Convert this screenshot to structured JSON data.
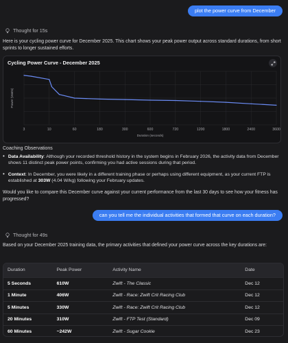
{
  "messages": {
    "user_1": "plot the power curve from December",
    "thought_1": "Thought for 15s",
    "intro": "Here is your cycling power curve for December 2025. This chart shows your peak power output across standard durations, from short sprints to longer sustained efforts.",
    "observations_heading": "Coaching Observations",
    "bullets": [
      {
        "label": "Data Availability",
        "text": ": Although your recorded threshold history in the system begins in February 2026, the activity data from December shows 11 distinct peak power points, confirming you had active sessions during that period."
      },
      {
        "label": "Context",
        "text": ": In December, you were likely in a different training phase or perhaps using different equipment, as your current FTP is established at ",
        "bold2": "303W",
        "tail": " (4.04 W/kg) following your February updates."
      }
    ],
    "followup_question": "Would you like to compare this December curve against your current performance from the last 30 days to see how your fitness has progressed?",
    "user_2": "can you tell me the individual activities that formed that curve on each duration?",
    "thought_2": "Thought for 49s",
    "answer_intro": "Based on your December 2025 training data, the primary activities that defined your power curve across the key durations are:"
  },
  "chart_data": {
    "type": "line",
    "title": "Cycling Power Curve - December 2025",
    "xlabel": "Duration (seconds)",
    "ylabel": "Power (Watts)",
    "x_ticks": [
      "3",
      "10",
      "60",
      "180",
      "300",
      "600",
      "720",
      "1200",
      "1800",
      "2400",
      "3600"
    ],
    "x": [
      3,
      5,
      10,
      15,
      30,
      60,
      180,
      300,
      600,
      720,
      1200,
      1800,
      2400,
      3600
    ],
    "y": [
      610,
      600,
      560,
      470,
      375,
      330,
      318,
      312,
      305,
      300,
      290,
      278,
      260,
      242
    ],
    "ylim": [
      0,
      660
    ],
    "grid": true,
    "line_color": "#6b8cf5"
  },
  "table": {
    "headers": [
      "Duration",
      "Peak Power",
      "Activity Name",
      "Date"
    ],
    "rows": [
      [
        "5 Seconds",
        "610W",
        "Zwift - The Classic",
        "Dec 12"
      ],
      [
        "1 Minute",
        "406W",
        "Zwift - Race: Zwift Crit Racing Club",
        "Dec 12"
      ],
      [
        "5 Minutes",
        "330W",
        "Zwift - Race: Zwift Crit Racing Club",
        "Dec 12"
      ],
      [
        "20 Minutes",
        "310W",
        "Zwift - FTP Test (Standard)",
        "Dec 09"
      ],
      [
        "60 Minutes",
        "~242W",
        "Zwift - Sugar Cookie",
        "Dec 23"
      ]
    ]
  }
}
